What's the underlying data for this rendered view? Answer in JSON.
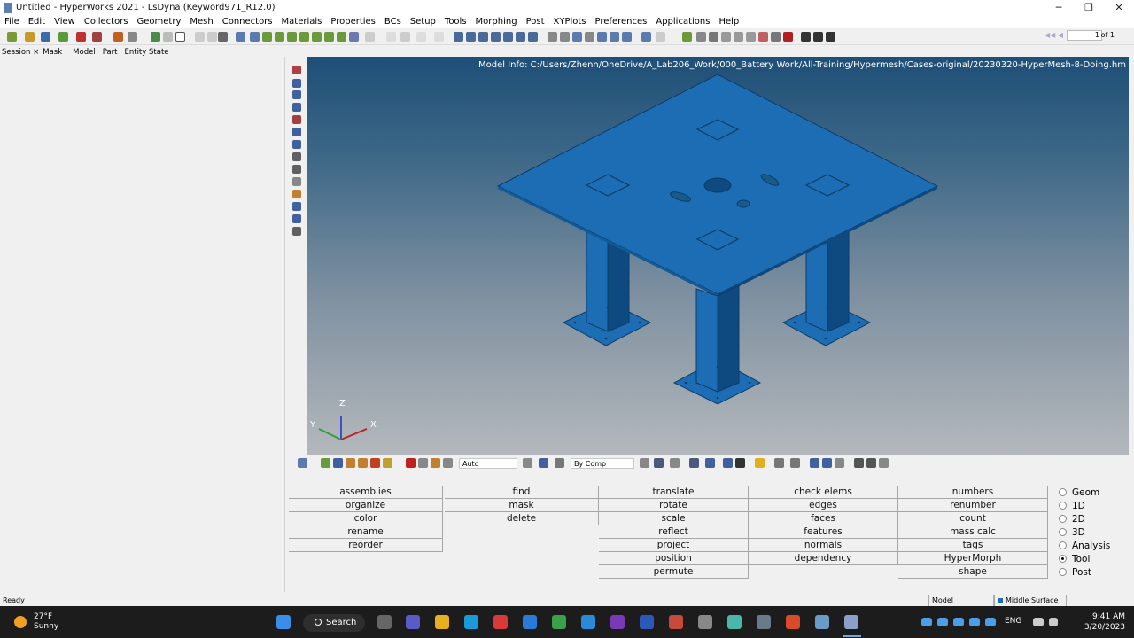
{
  "window": {
    "title": "Untitled - HyperWorks 2021 - LsDyna (Keyword971_R12.0)",
    "minimize": "─",
    "maximize": "❐",
    "close": "✕"
  },
  "menu": [
    "File",
    "Edit",
    "View",
    "Collectors",
    "Geometry",
    "Mesh",
    "Connectors",
    "Materials",
    "Properties",
    "BCs",
    "Setup",
    "Tools",
    "Morphing",
    "Post",
    "XYPlots",
    "Preferences",
    "Applications",
    "Help"
  ],
  "pager": {
    "page": "1",
    "of": "of 1"
  },
  "browser_tabs": [
    "Session ×",
    "Mask",
    "Model",
    "Part",
    "Entity State"
  ],
  "viewport": {
    "model_info": "Model Info: C:/Users/Zhenn/OneDrive/A_Lab206_Work/000_Battery Work/All-Training/Hypermesh/Cases-original/20230320-HyperMesh-8-Doing.hm",
    "axes": {
      "x": "X",
      "y": "Y",
      "z": "Z"
    },
    "colors": {
      "part": "#1c6db3",
      "part_edge": "#0c3c68",
      "dark_face": "#0e4a80"
    }
  },
  "vp_toolbar": {
    "auto_select": "Auto",
    "color_mode": "By Comp"
  },
  "panel": {
    "columns": [
      [
        "assemblies",
        "organize",
        "color",
        "rename",
        "reorder"
      ],
      [
        "find",
        "mask",
        "delete"
      ],
      [
        "translate",
        "rotate",
        "scale",
        "reflect",
        "project",
        "position",
        "permute"
      ],
      [
        "check elems",
        "edges",
        "faces",
        "features",
        "normals",
        "dependency"
      ],
      [
        "numbers",
        "renumber",
        "count",
        "mass calc",
        "tags",
        "HyperMorph",
        "shape"
      ]
    ],
    "radios": [
      {
        "label": "Geom",
        "checked": false
      },
      {
        "label": "1D",
        "checked": false
      },
      {
        "label": "2D",
        "checked": false
      },
      {
        "label": "3D",
        "checked": false
      },
      {
        "label": "Analysis",
        "checked": false
      },
      {
        "label": "Tool",
        "checked": true
      },
      {
        "label": "Post",
        "checked": false
      }
    ]
  },
  "status": {
    "left": "Ready",
    "model": "Model",
    "layer": "Middle Surface"
  },
  "taskbar": {
    "temp": "27°F",
    "weather": "Sunny",
    "search": "Search",
    "lang": "ENG",
    "time": "9:41 AM",
    "date": "3/20/2023"
  }
}
